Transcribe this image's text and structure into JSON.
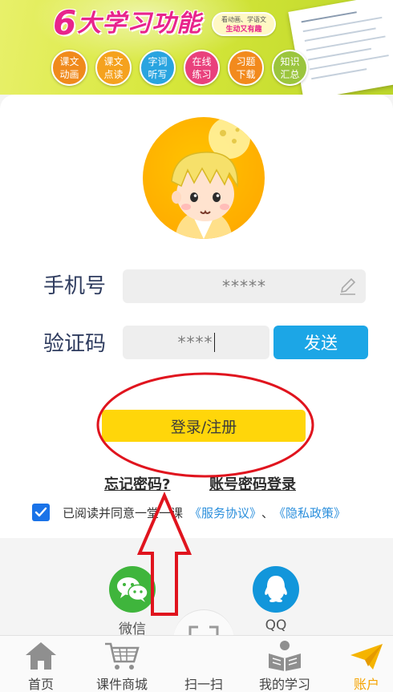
{
  "banner": {
    "title_number": "6",
    "title": "大学习功能",
    "slogan_line1": "看动画、学语文",
    "slogan_line2": "生动又有趣",
    "features": [
      {
        "label": "课文\n动画",
        "color": "#f08a1c"
      },
      {
        "label": "课文\n点读",
        "color": "#f5a21e"
      },
      {
        "label": "字词\n听写",
        "color": "#29a4e0"
      },
      {
        "label": "在线\n练习",
        "color": "#e9417c"
      },
      {
        "label": "习题\n下载",
        "color": "#f28a1d"
      },
      {
        "label": "知识\n汇总",
        "color": "#9bc53d"
      }
    ]
  },
  "login": {
    "phone_label": "手机号",
    "phone_value": "*****",
    "code_label": "验证码",
    "code_value": "****",
    "send_label": "发送",
    "submit_label": "登录/注册",
    "forgot_label": "忘记密码?",
    "password_login_label": "账号密码登录",
    "agree_text": "已阅读并同意一堂一课",
    "service_agreement": "《服务协议》",
    "separator": "、",
    "privacy_policy": "《隐私政策》",
    "agree_checked": true
  },
  "social": {
    "wechat_label": "微信",
    "qq_label": "QQ",
    "wechat_color": "#3fb53c",
    "qq_color": "#1296db"
  },
  "nav": {
    "items": [
      {
        "label": "首页",
        "icon": "home-icon"
      },
      {
        "label": "课件商城",
        "icon": "cart-icon"
      },
      {
        "label": "扫一扫",
        "icon": "scan-icon"
      },
      {
        "label": "我的学习",
        "icon": "reading-icon"
      },
      {
        "label": "账户",
        "icon": "paper-plane-icon",
        "active": true
      }
    ],
    "active_color": "#f5a300"
  },
  "colors": {
    "accent_yellow": "#ffd60a",
    "send_blue": "#1ca6e6",
    "annotation_red": "#e0141e"
  }
}
